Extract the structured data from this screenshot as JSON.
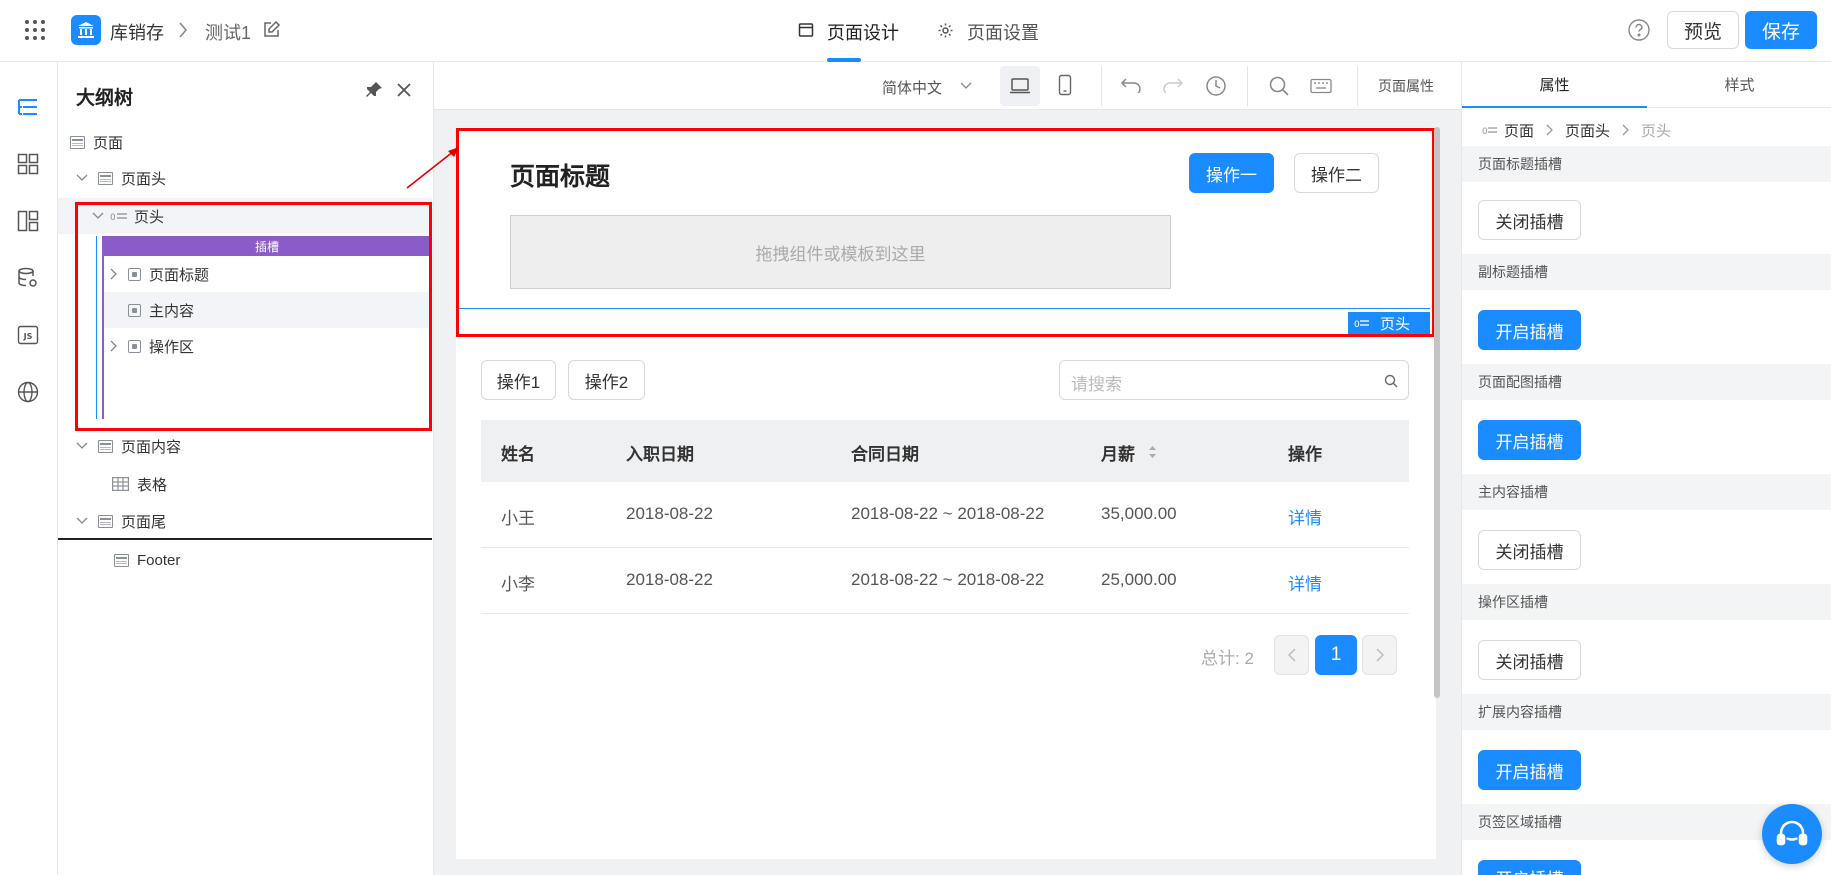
{
  "topbar": {
    "app_name": "库销存",
    "page_name": "测试1",
    "tabs": [
      {
        "label": "页面设计",
        "active": true
      },
      {
        "label": "页面设置",
        "active": false
      }
    ],
    "preview_label": "预览",
    "save_label": "保存"
  },
  "outline": {
    "title": "大纲树",
    "nodes": [
      {
        "label": "页面"
      },
      {
        "label": "页面头"
      },
      {
        "label": "页头"
      },
      {
        "label": "插槽"
      },
      {
        "label": "页面标题"
      },
      {
        "label": "主内容"
      },
      {
        "label": "操作区"
      },
      {
        "label": "页面内容"
      },
      {
        "label": "表格"
      },
      {
        "label": "页面尾"
      },
      {
        "label": "Footer"
      }
    ]
  },
  "canvas_toolbar": {
    "language": "简体中文",
    "page_props_label": "页面属性"
  },
  "page_header": {
    "title": "页面标题",
    "action1": "操作一",
    "action2": "操作二",
    "drop_hint": "拖拽组件或模板到这里",
    "tag_label": "页头"
  },
  "table_toolbar": {
    "btn1": "操作1",
    "btn2": "操作2",
    "search_placeholder": "请搜索"
  },
  "table": {
    "columns": [
      "姓名",
      "入职日期",
      "合同日期",
      "月薪",
      "操作"
    ],
    "rows": [
      [
        "小王",
        "2018-08-22",
        "2018-08-22 ~ 2018-08-22",
        "35,000.00",
        "详情"
      ],
      [
        "小李",
        "2018-08-22",
        "2018-08-22 ~ 2018-08-22",
        "25,000.00",
        "详情"
      ]
    ]
  },
  "pagination": {
    "total_label": "总计: 2",
    "current_page": "1"
  },
  "props_panel": {
    "tabs": [
      "属性",
      "样式"
    ],
    "breadcrumb": [
      "页面",
      "页面头",
      "页头"
    ],
    "sections": [
      {
        "title": "页面标题插槽",
        "button": "关闭插槽",
        "enabled": false
      },
      {
        "title": "副标题插槽",
        "button": "开启插槽",
        "enabled": true
      },
      {
        "title": "页面配图插槽",
        "button": "开启插槽",
        "enabled": true
      },
      {
        "title": "主内容插槽",
        "button": "关闭插槽",
        "enabled": false
      },
      {
        "title": "操作区插槽",
        "button": "关闭插槽",
        "enabled": false
      },
      {
        "title": "扩展内容插槽",
        "button": "开启插槽",
        "enabled": true
      },
      {
        "title": "页签区域插槽",
        "button": "开启插槽",
        "enabled": true
      }
    ]
  },
  "colors": {
    "primary": "#1a8cff",
    "highlight": "#ff0000",
    "slot_bar": "#8b5cc7",
    "link": "#1a8cff"
  }
}
